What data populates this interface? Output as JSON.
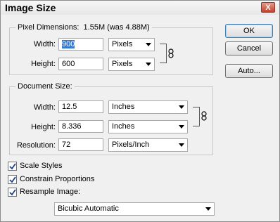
{
  "window": {
    "title": "Image Size",
    "close_glyph": "X"
  },
  "pixel_dimensions": {
    "label": "Pixel Dimensions:",
    "summary": "1.55M (was 4.88M)",
    "width_label": "Width:",
    "width_value": "900",
    "width_unit": "Pixels",
    "height_label": "Height:",
    "height_value": "600",
    "height_unit": "Pixels"
  },
  "document_size": {
    "label": "Document Size:",
    "width_label": "Width:",
    "width_value": "12.5",
    "width_unit": "Inches",
    "height_label": "Height:",
    "height_value": "8.336",
    "height_unit": "Inches",
    "resolution_label": "Resolution:",
    "resolution_value": "72",
    "resolution_unit": "Pixels/Inch"
  },
  "options": {
    "scale_styles": {
      "label": "Scale Styles",
      "checked": true
    },
    "constrain_proportions": {
      "label": "Constrain Proportions",
      "checked": true
    },
    "resample_image": {
      "label": "Resample Image:",
      "checked": true
    },
    "resample_method": "Bicubic Automatic"
  },
  "buttons": {
    "ok": "OK",
    "cancel": "Cancel",
    "auto": "Auto..."
  },
  "icons": {
    "link": "chain-link-icon",
    "close": "close-icon",
    "check": "checkmark-icon"
  }
}
